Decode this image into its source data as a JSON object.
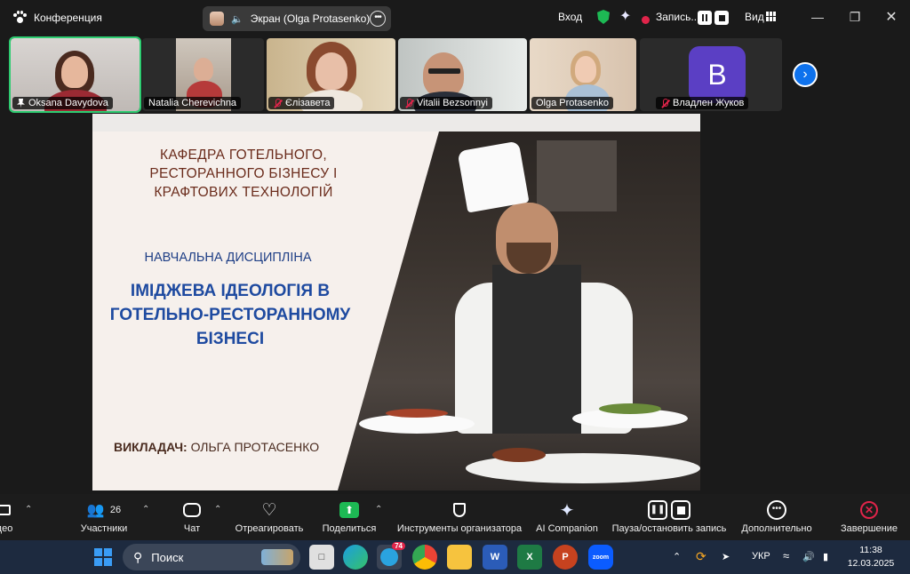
{
  "topbar": {
    "app_title": "Конференция",
    "screen_share_label": "Экран (Olga Protasenko)",
    "join_label": "Вход",
    "recording_label": "Запись...",
    "view_label": "Вид",
    "icons": [
      "zoom-paw-icon",
      "speaker-icon",
      "more-icon",
      "shield-icon",
      "ai-sparkle-icon",
      "cloud-record-icon",
      "pause-icon",
      "stop-icon",
      "grid-icon",
      "minimize-icon",
      "restore-icon",
      "close-icon"
    ]
  },
  "gallery": {
    "participants": [
      {
        "name": "Oksana Davydova",
        "muted": false,
        "pinned": true,
        "active_speaker": true
      },
      {
        "name": "Natalia Cherevichna",
        "muted": false
      },
      {
        "name": "Єлізавета",
        "muted": true
      },
      {
        "name": "Vitalii Bezsonnyi",
        "muted": true
      },
      {
        "name": "Olga Protasenko",
        "muted": false
      },
      {
        "name": "Владлен Жуков",
        "muted": true,
        "avatar_letter": "B",
        "avatar_color": "#5b3fc4"
      }
    ],
    "next_icon": "chevron-right-icon"
  },
  "slide": {
    "department": "КАФЕДРА ГОТЕЛЬНОГО, РЕСТОРАННОГО БІЗНЕСУ І КРАФТОВИХ ТЕХНОЛОГІЙ",
    "discipline_label": "НАВЧАЛЬНА ДИСЦИПЛІНА",
    "course_title": "ІМІДЖЕВА ІДЕОЛОГІЯ В ГОТЕЛЬНО-РЕСТОРАННОМУ БІЗНЕСІ",
    "teacher_label": "ВИКЛАДАЧ:",
    "teacher_name": "ОЛЬГА ПРОТАСЕНКО",
    "colors": {
      "department": "#6b2c1c",
      "course": "#1e4aa0",
      "background": "#f6f0ec"
    }
  },
  "toolbar": {
    "video_label": "део",
    "participants_label": "Участники",
    "participants_count": "26",
    "chat_label": "Чат",
    "react_label": "Отреагировать",
    "share_label": "Поделиться",
    "host_tools_label": "Инструменты организатора",
    "ai_label": "AI Companion",
    "pause_record_label": "Пауза/остановить запись",
    "more_label": "Дополнительно",
    "end_label": "Завершение",
    "colors": {
      "share": "#1db954",
      "end": "#e0244a"
    }
  },
  "taskbar": {
    "search_placeholder": "Поиск",
    "telegram_badge": "74",
    "zoom_label": "zoom",
    "language": "УКР",
    "time": "11:38",
    "date": "12.03.2025"
  }
}
